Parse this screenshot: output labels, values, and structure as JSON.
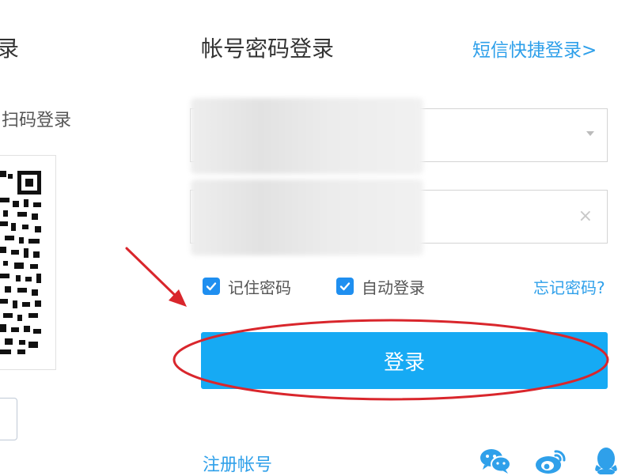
{
  "qr_panel": {
    "title": "录",
    "subtitle": "扫码登录"
  },
  "form": {
    "title": "帐号密码登录",
    "sms_login_link": "短信快捷登录>",
    "username": {
      "value": "",
      "placeholder": ""
    },
    "password": {
      "value": "",
      "placeholder": ""
    },
    "remember_password": {
      "label": "记住密码",
      "checked": true
    },
    "auto_login": {
      "label": "自动登录",
      "checked": true
    },
    "forgot_link": "忘记密码?",
    "login_button": "登录",
    "register_link": "注册帐号"
  },
  "social_icons": [
    "wechat-icon",
    "weibo-icon",
    "qq-icon"
  ],
  "colors": {
    "link": "#2fa0ea",
    "primary_button": "#16aaf4",
    "checkbox": "#1f8ff0",
    "annotation": "#d9262c"
  }
}
